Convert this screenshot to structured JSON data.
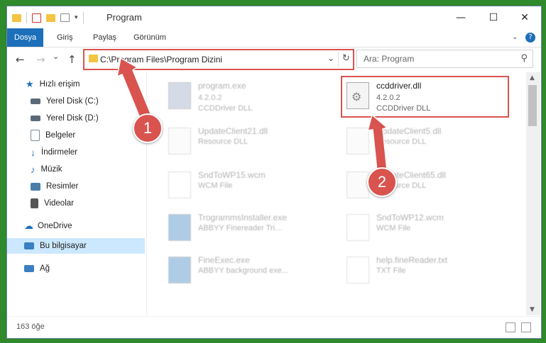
{
  "window": {
    "title": "Program",
    "minimize_label": "—",
    "maximize_label": "☐",
    "close_label": "✕"
  },
  "ribbon": {
    "tabs": [
      "Dosya",
      "Giriş",
      "Paylaş",
      "Görünüm"
    ],
    "expand_icon": "chevron-down-icon",
    "help_label": "?"
  },
  "nav": {
    "back": "←",
    "forward": "→",
    "recent": "⌄",
    "up": "↑",
    "path": "C:\\Program Files\\Program Dizini",
    "search_placeholder": "Ara: Program"
  },
  "sidebar": {
    "items": [
      {
        "label": "Hızlı erişim",
        "icon": "star-icon",
        "color": "#1e6fb9",
        "pinned": false
      },
      {
        "label": "Yerel Disk (C:)",
        "icon": "drive-icon",
        "color": "#5a6a7a",
        "pinned": false
      },
      {
        "label": "Yerel Disk (D:)",
        "icon": "drive-icon",
        "color": "#5a6a7a",
        "pinned": false
      },
      {
        "label": "Belgeler",
        "icon": "documents-icon",
        "color": "#7a8a9a",
        "pinned": true
      },
      {
        "label": "İndirmeler",
        "icon": "download-icon",
        "color": "#1e6fb9",
        "pinned": true
      },
      {
        "label": "Müzik",
        "icon": "music-icon",
        "color": "#1e6fb9",
        "pinned": true
      },
      {
        "label": "Resimler",
        "icon": "pictures-icon",
        "color": "#4a7ea8",
        "pinned": true
      },
      {
        "label": "Videolar",
        "icon": "videos-icon",
        "color": "#555555",
        "pinned": true
      },
      {
        "label": "OneDrive",
        "icon": "cloud-icon",
        "color": "#1e6fb9",
        "pinned": false
      },
      {
        "label": "Bu bilgisayar",
        "icon": "computer-icon",
        "color": "#3a7fc1",
        "pinned": false
      },
      {
        "label": "Ağ",
        "icon": "network-icon",
        "color": "#3a7fc1",
        "pinned": false
      }
    ]
  },
  "files": [
    {
      "name": "program.exe",
      "line2": "4.2.0.2",
      "line3": "CCDDriver DLL",
      "icon": "exe-icon",
      "faded": true
    },
    {
      "name": "ccddriver.dll",
      "line2": "4.2.0.2",
      "line3": "CCDDriver DLL",
      "icon": "dll-gear-icon",
      "faded": false
    },
    {
      "name": "UpdateClient21.dll",
      "line2": "Resource DLL",
      "icon": "dll-gear-icon",
      "faded": true
    },
    {
      "name": "UpdateClient5.dll",
      "line2": "Resource DLL",
      "icon": "dll-gear-icon",
      "faded": true
    },
    {
      "name": "SndToWP15.wcm",
      "line2": "WCM File",
      "icon": "file-icon",
      "faded": true
    },
    {
      "name": "UpdateClient65.dll",
      "line2": "Resource DLL",
      "icon": "dll-gear-icon",
      "faded": true
    },
    {
      "name": "TrogrammsInstaller.exe",
      "line2": "ABBYY Finereader Tri...",
      "icon": "app-window-icon",
      "faded": true
    },
    {
      "name": "SndToWP12.wcm",
      "line2": "WCM File",
      "icon": "file-icon",
      "faded": true
    },
    {
      "name": "FineExec.exe",
      "line2": "ABBYY background exe...",
      "icon": "app-window-icon",
      "faded": true
    },
    {
      "name": "help.fineReader.txt",
      "line2": "TXT File",
      "icon": "file-icon",
      "faded": true
    }
  ],
  "status": {
    "count": "163 öğe"
  },
  "callouts": [
    "1",
    "2"
  ],
  "colors": {
    "accent": "#1e6fb9",
    "highlight": "#d9534f",
    "folder": "#f4c542"
  }
}
